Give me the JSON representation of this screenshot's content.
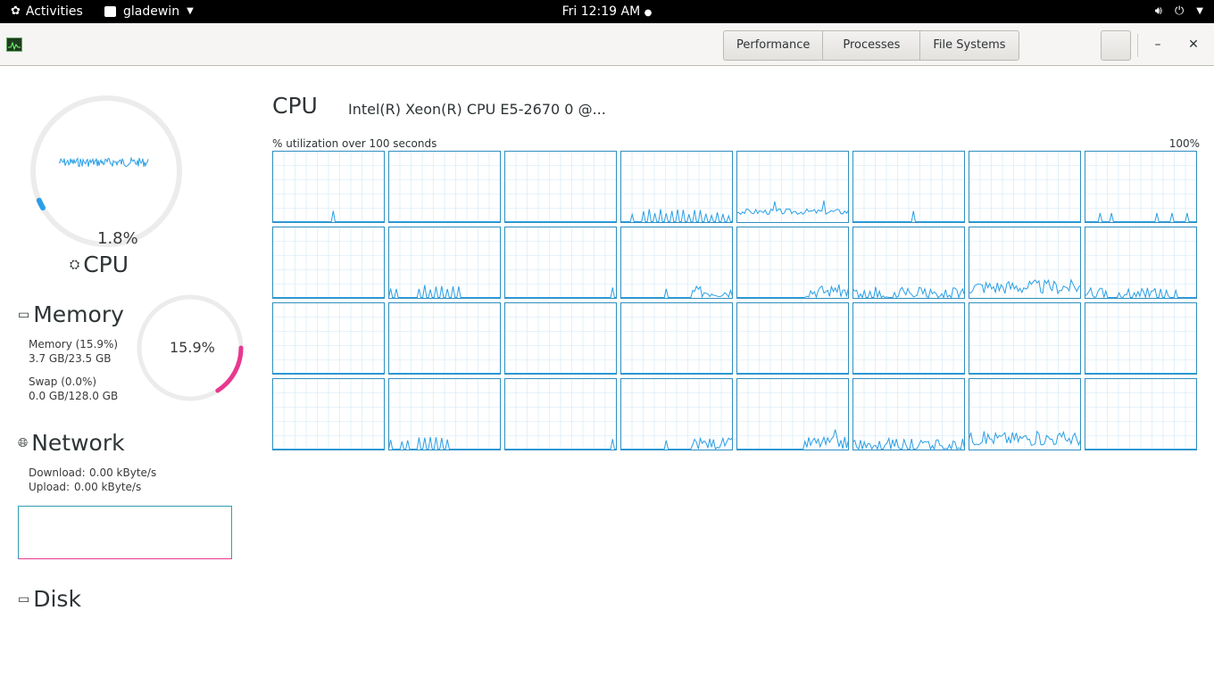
{
  "topbar": {
    "activities": "Activities",
    "app_name": "gladewin",
    "clock": "Fri 12:19 AM"
  },
  "header": {
    "tabs": [
      "Performance",
      "Processes",
      "File Systems"
    ]
  },
  "sidebar": {
    "cpu": {
      "label": "CPU",
      "percent": "1.8%",
      "fraction": 0.018
    },
    "memory": {
      "label": "Memory",
      "percent": "15.9%",
      "fraction": 0.159,
      "mem_line1": "Memory (15.9%)",
      "mem_line2": "3.7 GB/23.5 GB",
      "swap_line1": "Swap (0.0%)",
      "swap_line2": "0.0 GB/128.0 GB"
    },
    "network": {
      "label": "Network",
      "download_label": "Download:",
      "download_value": "0.00 kByte/s",
      "upload_label": "Upload:",
      "upload_value": "0.00 kByte/s"
    },
    "disk": {
      "label": "Disk"
    }
  },
  "main": {
    "title": "CPU",
    "model": "Intel(R) Xeon(R) CPU E5-2670 0 @...",
    "util_label": "% utilization over 100 seconds",
    "util_max": "100%"
  },
  "colors": {
    "cpu_accent": "#2a9fe6",
    "memory_accent": "#e8388f",
    "graph_border": "#2f8fbf",
    "graph_grid": "#cfe8f6"
  },
  "chart_data": {
    "type": "line",
    "cores": 32,
    "ylim": [
      0,
      100
    ],
    "activity": [
      "spike",
      "idle",
      "idle",
      "periodic",
      "busy",
      "spike",
      "idle",
      "sparse",
      "idle",
      "burst_left",
      "late_spike",
      "late_burst",
      "late_rise",
      "noisy",
      "dense",
      "noisy_mid",
      "idle",
      "idle",
      "idle",
      "idle",
      "idle",
      "idle",
      "idle",
      "idle",
      "idle",
      "burst_left",
      "late_spike",
      "late_burst",
      "late_rise",
      "noisy",
      "dense",
      "idle"
    ]
  }
}
